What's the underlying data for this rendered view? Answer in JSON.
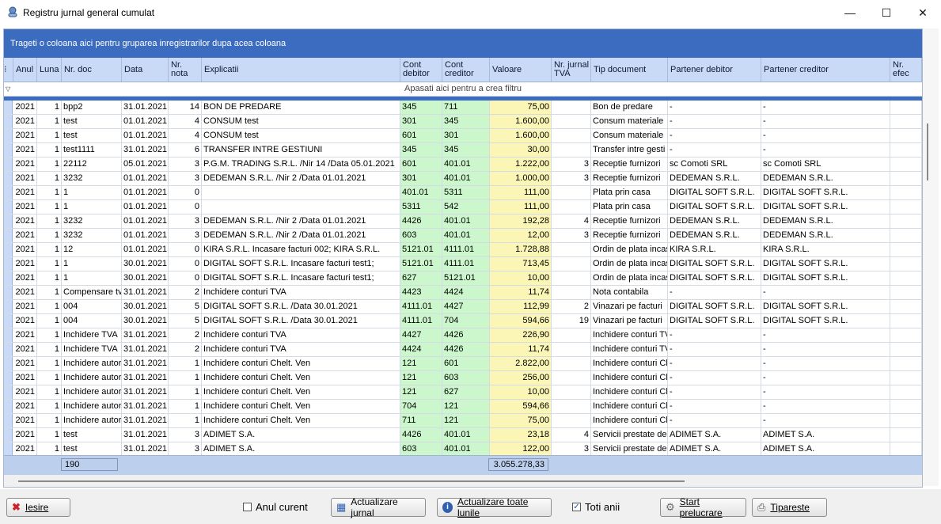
{
  "window": {
    "title": "Registru jurnal general cumulat",
    "minimize": "—",
    "maximize": "☐",
    "close": "✕"
  },
  "grid": {
    "group_hint": "Trageti o coloana aici pentru gruparea inregistrarilor dupa acea coloana",
    "filter_hint": "Apasati aici pentru a  crea filtru",
    "columns": [
      "Anul",
      "Luna",
      "Nr. doc",
      "Data",
      "Nr.\nnota",
      "Explicatii",
      "Cont\ndebitor",
      "Cont\ncreditor",
      "Valoare",
      "Nr. jurnal\nTVA",
      "Tip document",
      "Partener debitor",
      "Partener creditor",
      "Nr. efec"
    ],
    "rows": [
      [
        "2021",
        "1",
        "bpp2",
        "31.01.2021",
        "14",
        "BON DE PREDARE",
        "345",
        "711",
        "75,00",
        "",
        "Bon de predare",
        "-",
        "-",
        ""
      ],
      [
        "2021",
        "1",
        "test",
        "01.01.2021",
        "4",
        "CONSUM test",
        "301",
        "345",
        "1.600,00",
        "",
        "Consum materiale",
        "-",
        "-",
        ""
      ],
      [
        "2021",
        "1",
        "test",
        "01.01.2021",
        "4",
        "CONSUM test",
        "601",
        "301",
        "1.600,00",
        "",
        "Consum materiale",
        "-",
        "-",
        ""
      ],
      [
        "2021",
        "1",
        "test1111",
        "31.01.2021",
        "6",
        "TRANSFER INTRE GESTIUNI",
        "345",
        "345",
        "30,00",
        "",
        "Transfer intre gesti",
        "-",
        "-",
        ""
      ],
      [
        "2021",
        "1",
        "22112",
        "05.01.2021",
        "3",
        "P.G.M. TRADING S.R.L. /Nir 14  /Data 05.01.2021",
        "601",
        "401.01",
        "1.222,00",
        "3",
        "Receptie furnizori",
        "sc Comoti SRL",
        "sc Comoti SRL",
        ""
      ],
      [
        "2021",
        "1",
        "3232",
        "01.01.2021",
        "3",
        "DEDEMAN S.R.L. /Nir 2  /Data 01.01.2021",
        "301",
        "401.01",
        "1.000,00",
        "3",
        "Receptie furnizori",
        "DEDEMAN S.R.L.",
        "DEDEMAN S.R.L.",
        ""
      ],
      [
        "2021",
        "1",
        "1",
        "01.01.2021",
        "0",
        "",
        "401.01",
        "5311",
        "111,00",
        "",
        "Plata prin casa",
        "DIGITAL SOFT S.R.L.",
        "DIGITAL SOFT S.R.L.",
        ""
      ],
      [
        "2021",
        "1",
        "1",
        "01.01.2021",
        "0",
        "",
        "5311",
        "542",
        "111,00",
        "",
        "Plata prin casa",
        "DIGITAL SOFT S.R.L.",
        "DIGITAL SOFT S.R.L.",
        ""
      ],
      [
        "2021",
        "1",
        "3232",
        "01.01.2021",
        "3",
        "DEDEMAN S.R.L. /Nir 2  /Data 01.01.2021",
        "4426",
        "401.01",
        "192,28",
        "4",
        "Receptie furnizori",
        "DEDEMAN S.R.L.",
        "DEDEMAN S.R.L.",
        ""
      ],
      [
        "2021",
        "1",
        "3232",
        "01.01.2021",
        "3",
        "DEDEMAN S.R.L. /Nir 2  /Data 01.01.2021",
        "603",
        "401.01",
        "12,00",
        "3",
        "Receptie furnizori",
        "DEDEMAN S.R.L.",
        "DEDEMAN S.R.L.",
        ""
      ],
      [
        "2021",
        "1",
        "12",
        "01.01.2021",
        "0",
        "KIRA S.R.L. Incasare facturi 002; KIRA S.R.L.",
        "5121.01",
        "4111.01",
        "1.728,88",
        "",
        "Ordin de plata incas",
        "KIRA S.R.L.",
        "KIRA S.R.L.",
        ""
      ],
      [
        "2021",
        "1",
        "1",
        "30.01.2021",
        "0",
        "DIGITAL SOFT S.R.L. Incasare facturi test1;",
        "5121.01",
        "4111.01",
        "713,45",
        "",
        "Ordin de plata incas",
        "DIGITAL SOFT S.R.L.",
        "DIGITAL SOFT S.R.L.",
        ""
      ],
      [
        "2021",
        "1",
        "1",
        "30.01.2021",
        "0",
        "DIGITAL SOFT S.R.L. Incasare facturi test1;",
        "627",
        "5121.01",
        "10,00",
        "",
        "Ordin de plata incas",
        "DIGITAL SOFT S.R.L.",
        "DIGITAL SOFT S.R.L.",
        ""
      ],
      [
        "2021",
        "1",
        "Compensare tv",
        "31.01.2021",
        "2",
        "Inchidere conturi TVA",
        "4423",
        "4424",
        "11,74",
        "",
        "Nota contabila",
        "-",
        "-",
        ""
      ],
      [
        "2021",
        "1",
        "004",
        "30.01.2021",
        "5",
        "DIGITAL SOFT S.R.L. /Data 30.01.2021",
        "4111.01",
        "4427",
        "112,99",
        "2",
        "Vinazari pe facturi",
        "DIGITAL SOFT S.R.L.",
        "DIGITAL SOFT S.R.L.",
        ""
      ],
      [
        "2021",
        "1",
        "004",
        "30.01.2021",
        "5",
        "DIGITAL SOFT S.R.L. /Data 30.01.2021",
        "4111.01",
        "704",
        "594,66",
        "19",
        "Vinazari pe facturi",
        "DIGITAL SOFT S.R.L.",
        "DIGITAL SOFT S.R.L.",
        ""
      ],
      [
        "2021",
        "1",
        "Inchidere TVA",
        "31.01.2021",
        "2",
        "Inchidere conturi TVA",
        "4427",
        "4426",
        "226,90",
        "",
        "Inchidere conturi TV",
        "-",
        "-",
        ""
      ],
      [
        "2021",
        "1",
        "Inchidere TVA",
        "31.01.2021",
        "2",
        "Inchidere conturi TVA",
        "4424",
        "4426",
        "11,74",
        "",
        "Inchidere conturi TV",
        "-",
        "-",
        ""
      ],
      [
        "2021",
        "1",
        "Inchidere autor",
        "31.01.2021",
        "1",
        "Inchidere conturi Chelt. Ven",
        "121",
        "601",
        "2.822,00",
        "",
        "Inchidere conturi Cl",
        "-",
        "-",
        ""
      ],
      [
        "2021",
        "1",
        "Inchidere autor",
        "31.01.2021",
        "1",
        "Inchidere conturi Chelt. Ven",
        "121",
        "603",
        "256,00",
        "",
        "Inchidere conturi Cl",
        "-",
        "-",
        ""
      ],
      [
        "2021",
        "1",
        "Inchidere autor",
        "31.01.2021",
        "1",
        "Inchidere conturi Chelt. Ven",
        "121",
        "627",
        "10,00",
        "",
        "Inchidere conturi Cl",
        "-",
        "-",
        ""
      ],
      [
        "2021",
        "1",
        "Inchidere autor",
        "31.01.2021",
        "1",
        "Inchidere conturi Chelt. Ven",
        "704",
        "121",
        "594,66",
        "",
        "Inchidere conturi Cl",
        "-",
        "-",
        ""
      ],
      [
        "2021",
        "1",
        "Inchidere autor",
        "31.01.2021",
        "1",
        "Inchidere conturi Chelt. Ven",
        "711",
        "121",
        "75,00",
        "",
        "Inchidere conturi Cl",
        "-",
        "-",
        ""
      ],
      [
        "2021",
        "1",
        "test",
        "31.01.2021",
        "3",
        "ADIMET S.A.",
        "4426",
        "401.01",
        "23,18",
        "4",
        "Servicii prestate de",
        "ADIMET S.A.",
        "ADIMET S.A.",
        ""
      ],
      [
        "2021",
        "1",
        "test",
        "31.01.2021",
        "3",
        "ADIMET S.A.",
        "603",
        "401.01",
        "122,00",
        "3",
        "Servicii prestate de",
        "ADIMET S.A.",
        "ADIMET S.A.",
        ""
      ]
    ],
    "footer_count": "190",
    "footer_total": "3.055.278,33",
    "colors": {
      "debit_bg": "#ccf7cc",
      "value_bg": "#fbf6b5",
      "header_bg": "#c8daf5",
      "group_bar": "#3b6cc0"
    }
  },
  "toolbar": {
    "exit_label": "Iesire",
    "anul_curent_label": "Anul curent",
    "anul_curent_checked": false,
    "update_journal_label": "Actualizare jurnal",
    "update_all_months_label": "Actualizare toate lunile",
    "toti_anii_label": "Toti anii",
    "toti_anii_checked": true,
    "start_label": "Start prelucrare",
    "print_label": "Tipareste"
  }
}
